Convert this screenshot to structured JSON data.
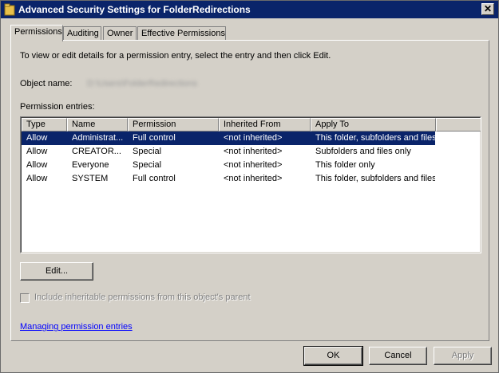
{
  "window": {
    "title": "Advanced Security Settings for FolderRedirections",
    "close_glyph": "✕"
  },
  "tabs": [
    {
      "label": "Permissions",
      "active": true
    },
    {
      "label": "Auditing",
      "active": false
    },
    {
      "label": "Owner",
      "active": false
    },
    {
      "label": "Effective Permissions",
      "active": false
    }
  ],
  "permissions": {
    "intro": "To view or edit details for a permission entry, select the entry and then click Edit.",
    "object_name_label": "Object name:",
    "object_name_value": "D:\\Users\\FolderRedirections",
    "entries_label": "Permission entries:",
    "columns": [
      "Type",
      "Name",
      "Permission",
      "Inherited From",
      "Apply To"
    ],
    "rows": [
      {
        "type": "Allow",
        "name": "Administrat...",
        "permission": "Full control",
        "inherited": "<not inherited>",
        "apply_to": "This folder, subfolders and files",
        "selected": true
      },
      {
        "type": "Allow",
        "name": "CREATOR...",
        "permission": "Special",
        "inherited": "<not inherited>",
        "apply_to": "Subfolders and files only",
        "selected": false
      },
      {
        "type": "Allow",
        "name": "Everyone",
        "permission": "Special",
        "inherited": "<not inherited>",
        "apply_to": "This folder only",
        "selected": false
      },
      {
        "type": "Allow",
        "name": "SYSTEM",
        "permission": "Full control",
        "inherited": "<not inherited>",
        "apply_to": "This folder, subfolders and files",
        "selected": false
      }
    ],
    "edit_button": "Edit...",
    "inherit_checkbox_label": "Include inheritable permissions from this object's parent",
    "inherit_checked": false,
    "managing_link": "Managing permission entries"
  },
  "footer": {
    "ok": "OK",
    "cancel": "Cancel",
    "apply": "Apply"
  },
  "colors": {
    "titlebar": "#0a246a",
    "selection": "#0a246a",
    "face": "#d4d0c8",
    "link": "#0000ff"
  }
}
